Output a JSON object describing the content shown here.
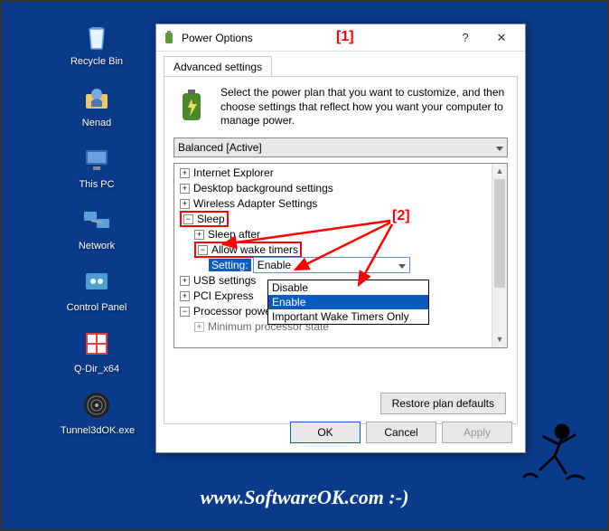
{
  "desktop": {
    "icons": [
      {
        "label": "Recycle Bin"
      },
      {
        "label": "Nenad"
      },
      {
        "label": "This PC"
      },
      {
        "label": "Network"
      },
      {
        "label": "Control Panel"
      },
      {
        "label": "Q-Dir_x64"
      },
      {
        "label": "Tunnel3dOK.exe"
      }
    ]
  },
  "dialog": {
    "title": "Power Options",
    "help": "?",
    "close": "✕",
    "tab_label": "Advanced settings",
    "intro_text": "Select the power plan that you want to customize, and then choose settings that reflect how you want your computer to manage power.",
    "plan": "Balanced [Active]",
    "tree": {
      "ie": "Internet Explorer",
      "desktop_bg": "Desktop background settings",
      "wireless": "Wireless Adapter Settings",
      "sleep": "Sleep",
      "sleep_after": "Sleep after",
      "allow_wake": "Allow wake timers",
      "setting_label": "Setting:",
      "setting_value": "Enable",
      "usb": "USB settings",
      "pci": "PCI Express",
      "cpu": "Processor power management",
      "cpu_min": "Minimum processor state"
    },
    "dropdown": {
      "opt1": "Disable",
      "opt2": "Enable",
      "opt3": "Important Wake Timers Only"
    },
    "restore": "Restore plan defaults",
    "ok": "OK",
    "cancel": "Cancel",
    "apply": "Apply"
  },
  "annotations": {
    "one": "[1]",
    "two": "[2]"
  },
  "footer": "www.SoftwareOK.com :-)"
}
